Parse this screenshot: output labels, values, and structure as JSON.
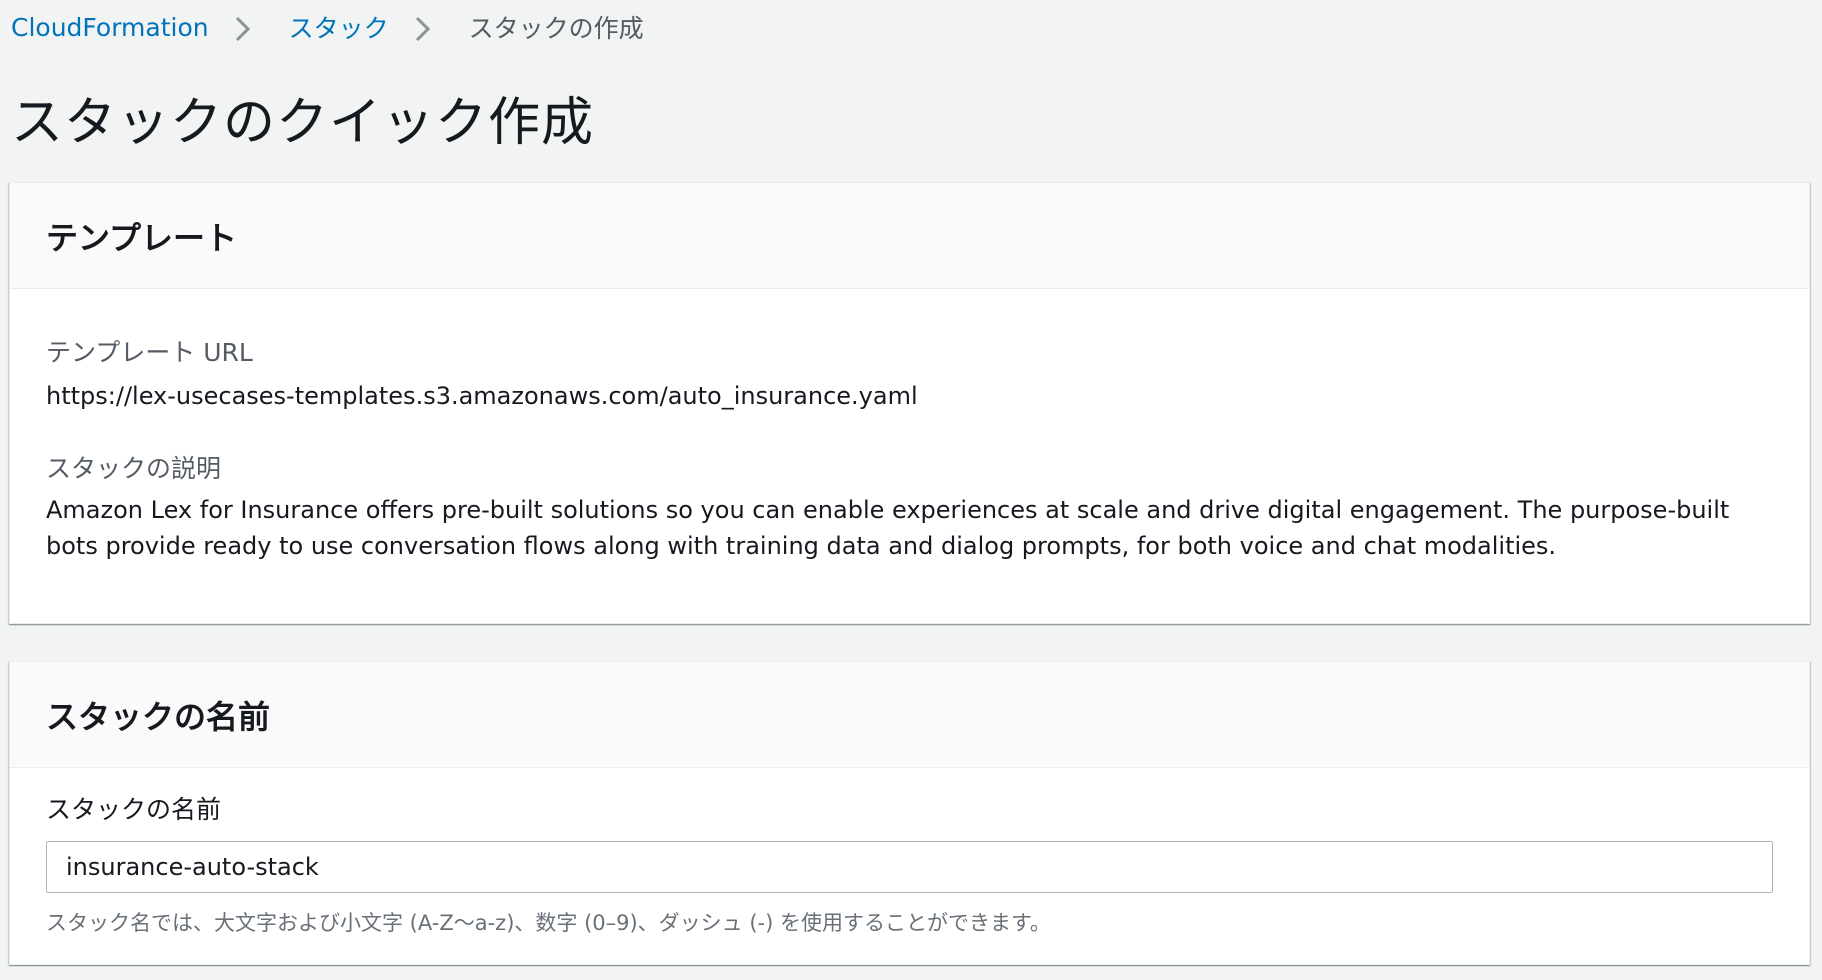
{
  "breadcrumb": {
    "items": [
      "CloudFormation",
      "スタック"
    ],
    "current": "スタックの作成"
  },
  "page": {
    "title": "スタックのクイック作成"
  },
  "template_section": {
    "heading": "テンプレート",
    "url_label": "テンプレート URL",
    "url_value": "https://lex-usecases-templates.s3.amazonaws.com/auto_insurance.yaml",
    "description_label": "スタックの説明",
    "description_value": "Amazon Lex for Insurance offers pre-built solutions so you can enable experiences at scale and drive digital engagement. The purpose-built bots provide ready to use conversation flows along with training data and dialog prompts, for both voice and chat modalities."
  },
  "stack_name_section": {
    "heading": "スタックの名前",
    "field_label": "スタックの名前",
    "field_value": "insurance-auto-stack",
    "constraint_text": "スタック名では、大文字および小文字 (A-Z〜a-z)、数字 (0–9)、ダッシュ (-) を使用することができます。"
  },
  "colors": {
    "link": "#0073bb",
    "background": "#f2f3f3",
    "panel_header": "#fafafa"
  }
}
